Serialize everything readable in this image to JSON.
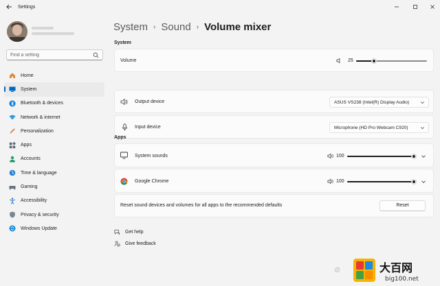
{
  "window": {
    "title": "Settings",
    "back_icon": "back-arrow-icon",
    "controls": [
      "minimize-icon",
      "maximize-icon",
      "close-icon"
    ]
  },
  "sidebar": {
    "search_placeholder": "Find a setting",
    "items": [
      {
        "label": "Home",
        "icon": "home-icon",
        "color": "#d88a3a",
        "active": false
      },
      {
        "label": "System",
        "icon": "system-icon",
        "color": "#0067c0",
        "active": true
      },
      {
        "label": "Bluetooth & devices",
        "icon": "bluetooth-icon",
        "color": "#0a78d4",
        "active": false
      },
      {
        "label": "Network & internet",
        "icon": "network-icon",
        "color": "#2d9ce3",
        "active": false
      },
      {
        "label": "Personalization",
        "icon": "personalization-icon",
        "color": "#e37b3b",
        "active": false
      },
      {
        "label": "Apps",
        "icon": "apps-icon",
        "color": "#5a6677",
        "active": false
      },
      {
        "label": "Accounts",
        "icon": "accounts-icon",
        "color": "#1f9a6d",
        "active": false
      },
      {
        "label": "Time & language",
        "icon": "time-language-icon",
        "color": "#2a83d6",
        "active": false
      },
      {
        "label": "Gaming",
        "icon": "gaming-icon",
        "color": "#6b7280",
        "active": false
      },
      {
        "label": "Accessibility",
        "icon": "accessibility-icon",
        "color": "#1a73c9",
        "active": false
      },
      {
        "label": "Privacy & security",
        "icon": "privacy-shield-icon",
        "color": "#7a8493",
        "active": false
      },
      {
        "label": "Windows Update",
        "icon": "windows-update-icon",
        "color": "#1e88d8",
        "active": false
      }
    ]
  },
  "breadcrumb": {
    "parts": [
      "System",
      "Sound"
    ],
    "current": "Volume mixer"
  },
  "system_section": {
    "title": "System",
    "volume": {
      "label": "Volume",
      "value": 25,
      "level": 0.25
    },
    "output": {
      "label": "Output device",
      "selected": "ASUS VS238 (Intel(R) Display Audio)"
    },
    "input": {
      "label": "Input device",
      "selected": "Microphone (HD Pro Webcam C920)"
    }
  },
  "apps_section": {
    "title": "Apps",
    "apps": [
      {
        "name": "System sounds",
        "icon": "monitor-icon",
        "volume": 100,
        "level": 1.0
      },
      {
        "name": "Google Chrome",
        "icon": "chrome-icon",
        "volume": 100,
        "level": 1.0
      }
    ],
    "reset_text": "Reset sound devices and volumes for all apps to the recommended defaults",
    "reset_button": "Reset"
  },
  "help": {
    "get_help": "Get help",
    "give_feedback": "Give feedback"
  },
  "watermark": {
    "text": "@",
    "logo_title": "大百网",
    "logo_url": "big100.net"
  },
  "colors": {
    "accent": "#0067c0",
    "page_bg": "#f3f3f3",
    "card_bg": "#fbfbfb"
  }
}
